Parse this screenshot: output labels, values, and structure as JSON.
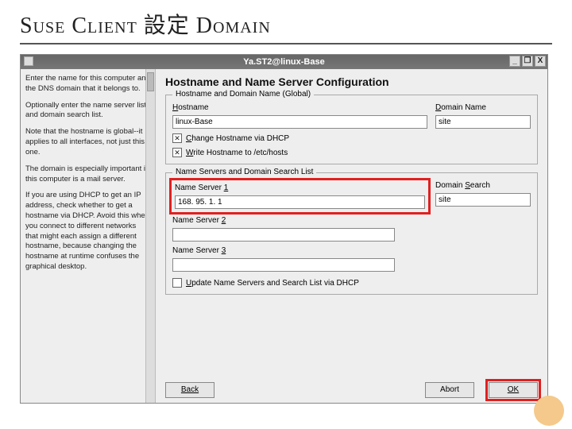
{
  "slide": {
    "title": "Suse Client 設定 Domain"
  },
  "window": {
    "title": "Ya.ST2@linux-Base",
    "controls": {
      "min": "_",
      "max": "❐",
      "close": "X"
    }
  },
  "help": {
    "p1": "Enter the name for this computer and the DNS domain that it belongs to.",
    "p2": "Optionally enter the name server list and domain search list.",
    "p3": "Note that the hostname is global--it applies to all interfaces, not just this one.",
    "p4": "The domain is especially important if this computer is a mail server.",
    "p5": "If you are using DHCP to get an IP address, check whether to get a hostname via DHCP. Avoid this when you connect to different networks that might each assign a different hostname, because changing the hostname at runtime confuses the graphical desktop."
  },
  "page": {
    "heading": "Hostname and Name Server Configuration"
  },
  "group1": {
    "legend": "Hostname and Domain Name (Global)",
    "hostname_label_pre": "H",
    "hostname_label_rest": "ostname",
    "hostname_value": "linux-Base",
    "domain_label_pre": "D",
    "domain_label_rest": "omain Name",
    "domain_value": "site",
    "chk1_pre": "C",
    "chk1_rest": "hange Hostname via DHCP",
    "chk2_pre": "W",
    "chk2_rest": "rite Hostname to /etc/hosts"
  },
  "group2": {
    "legend": "Name Servers and Domain Search List",
    "ns1_label": "Name Server ",
    "ns1_key": "1",
    "ns1_value": "168. 95. 1. 1",
    "ns2_label": "Name Server ",
    "ns2_key": "2",
    "ns2_value": "",
    "ns3_label": "Name Server ",
    "ns3_key": "3",
    "ns3_value": "",
    "ds_label": "Domain ",
    "ds_key": "S",
    "ds_rest": "earch",
    "ds_value": "site",
    "upd_pre": "U",
    "upd_rest": "pdate Name Servers and Search List via DHCP"
  },
  "buttons": {
    "back": "Back",
    "abort": "Abort",
    "ok": "OK"
  }
}
